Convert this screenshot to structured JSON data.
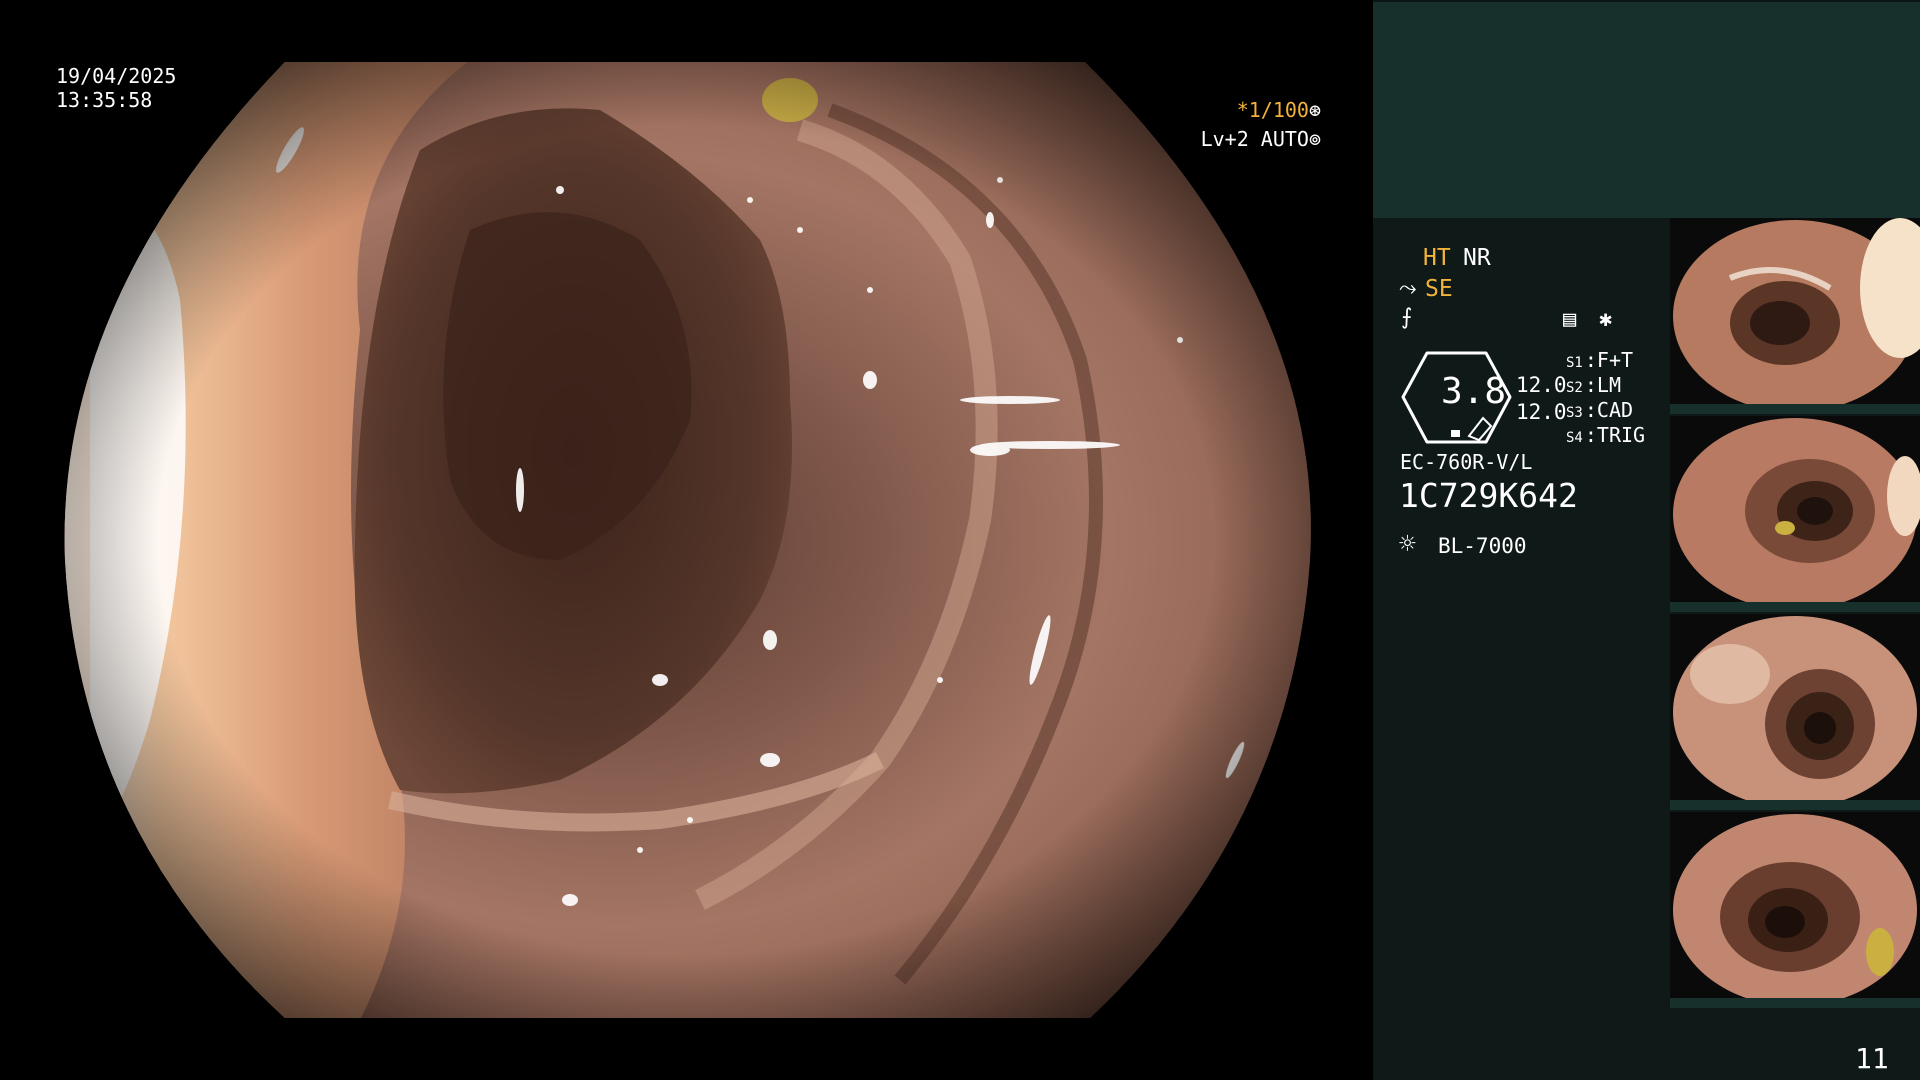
{
  "main": {
    "date": "19/04/2025",
    "time": "13:35:58",
    "shutter_speed": "*1/100",
    "light_level": "Lv+2 AUTO"
  },
  "panel": {
    "ht_label": "HT",
    "nr_label": "NR",
    "se_label": "SE",
    "hex_value": "3.8",
    "value_1": "12.0",
    "value_2": "12.0",
    "switches": [
      {
        "key": "S1",
        "value": "F+T"
      },
      {
        "key": "S2",
        "value": "LM"
      },
      {
        "key": "S3",
        "value": "CAD"
      },
      {
        "key": "S4",
        "value": "TRIG"
      }
    ],
    "scope_model": "EC-760R-V/L",
    "serial": "1C729K642",
    "light_source": "BL-7000",
    "page_number": "11"
  },
  "icons": {
    "shutter_glyph": "shutter-icon",
    "auto_glyph": "iris-icon",
    "se_glyph": "enhance-icon",
    "struct_glyph": "structure-icon",
    "menu_glyph": "menu-icon",
    "star_glyph": "star-icon",
    "sun_glyph": "lamp-icon"
  },
  "colors": {
    "amber": "#f3b33a",
    "panel_bg": "#0f1a18",
    "panel_header": "#17302c",
    "tissue": "#b98670"
  }
}
